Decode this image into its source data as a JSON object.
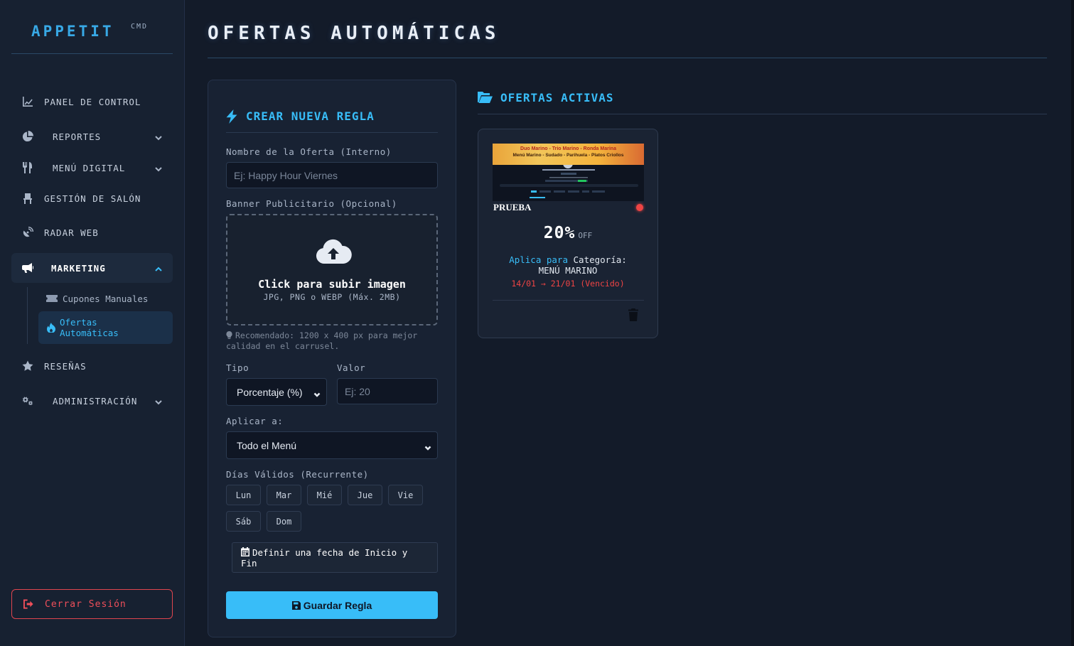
{
  "brand": {
    "name": "APPETIT",
    "sub": "CMD"
  },
  "sidebar": {
    "items": [
      {
        "label": "PANEL DE CONTROL",
        "icon": "chart-line-icon"
      },
      {
        "label": "REPORTES",
        "icon": "pie-chart-icon"
      },
      {
        "label": "MENÚ DIGITAL",
        "icon": "utensils-icon"
      },
      {
        "label": "GESTIÓN DE SALÓN",
        "icon": "chair-icon"
      },
      {
        "label": "RADAR WEB",
        "icon": "satellite-dish-icon"
      },
      {
        "label": "MARKETING",
        "icon": "megaphone-icon"
      },
      {
        "label": "RESEÑAS",
        "icon": "star-icon"
      },
      {
        "label": "ADMINISTRACIÓN",
        "icon": "gears-icon"
      }
    ],
    "marketing_sub": [
      {
        "label": "Cupones Manuales",
        "icon": "ticket-icon"
      },
      {
        "label": "Ofertas Automáticas",
        "icon": "fire-icon"
      }
    ],
    "logout": "Cerrar Sesión"
  },
  "page": {
    "title": "OFERTAS AUTOMÁTICAS"
  },
  "form": {
    "heading": "CREAR NUEVA REGLA",
    "name_label": "Nombre de la Oferta (Interno)",
    "name_placeholder": "Ej: Happy Hour Viernes",
    "banner_label": "Banner Publicitario (Opcional)",
    "upload_main": "Click para subir imagen",
    "upload_sub": "JPG, PNG o WEBP (Máx. 2MB)",
    "hint": "Recomendado: 1200 x 400 px para mejor calidad en el carrusel.",
    "type_label": "Tipo",
    "type_value": "Porcentaje (%)",
    "value_label": "Valor",
    "value_placeholder": "Ej: 20",
    "apply_label": "Aplicar a:",
    "apply_value": "Todo el Menú",
    "days_label": "Días Válidos (Recurrente)",
    "days": [
      "Lun",
      "Mar",
      "Mié",
      "Jue",
      "Vie",
      "Sáb",
      "Dom"
    ],
    "date_toggle": "Definir una fecha de Inicio y Fin",
    "save": "Guardar Regla"
  },
  "offers": {
    "heading": "OFERTAS ACTIVAS",
    "cards": [
      {
        "banner_line1": "Duo Marino - Trio Marino - Ronda Marina",
        "banner_line2": "Menú Marino - Sudado - Parihuela - Platos Criollos",
        "name": "PRUEBA",
        "status_color": "#ef4444",
        "value": "20%",
        "off": "OFF",
        "applies_prefix": "Aplica para",
        "applies_text": "Categoría:",
        "applies_target": "MENÚ MARINO",
        "dates": "14/01 → 21/01",
        "expired": "(Vencido)"
      }
    ]
  },
  "colors": {
    "accent": "#38bdf8",
    "danger": "#ef4444",
    "background": "#131b29",
    "panel": "#182233"
  }
}
